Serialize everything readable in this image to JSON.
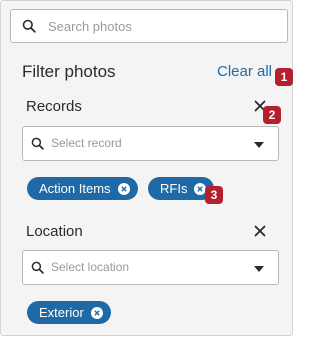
{
  "search": {
    "placeholder": "Search photos",
    "icon": "search-icon"
  },
  "filter": {
    "title": "Filter photos",
    "clear_all": "Clear all"
  },
  "sections": [
    {
      "title": "Records",
      "select_placeholder": "Select record",
      "chips": [
        {
          "label": "Action Items"
        },
        {
          "label": "RFIs"
        }
      ]
    },
    {
      "title": "Location",
      "select_placeholder": "Select location",
      "chips": [
        {
          "label": "Exterior"
        }
      ]
    }
  ],
  "annotations": [
    "1",
    "2",
    "3"
  ],
  "colors": {
    "accent": "#1f6aa6",
    "badge": "#b5202d",
    "panel": "#f4f4f4"
  }
}
